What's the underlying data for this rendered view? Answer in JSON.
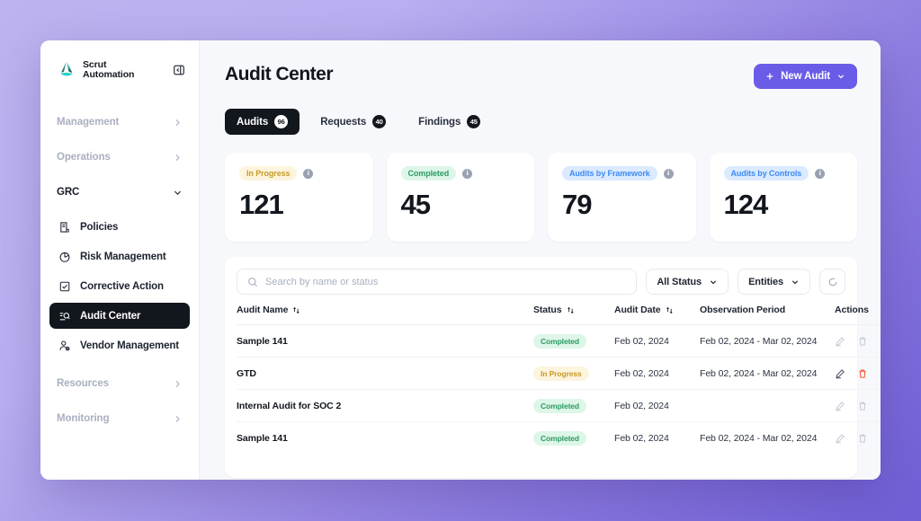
{
  "brand": {
    "name": "Scrut\nAutomation",
    "logo_icon": "scrut-logo-icon",
    "collapse_icon": "sidebar-collapse-icon"
  },
  "sidebar": {
    "groups": [
      {
        "label": "Management",
        "icon": "chevron-right-icon",
        "expanded": false
      },
      {
        "label": "Operations",
        "icon": "chevron-right-icon",
        "expanded": false
      },
      {
        "label": "GRC",
        "icon": "chevron-down-icon",
        "expanded": true
      }
    ],
    "items": [
      {
        "label": "Policies",
        "icon": "document-icon",
        "selected": false
      },
      {
        "label": "Risk Management",
        "icon": "pie-chart-icon",
        "selected": false
      },
      {
        "label": "Corrective Action",
        "icon": "checkbox-icon",
        "selected": false
      },
      {
        "label": "Audit Center",
        "icon": "audit-search-icon",
        "selected": true
      },
      {
        "label": "Vendor Management",
        "icon": "user-gear-icon",
        "selected": false
      }
    ],
    "groups_bottom": [
      {
        "label": "Resources",
        "icon": "chevron-right-icon"
      },
      {
        "label": "Monitoring",
        "icon": "chevron-right-icon"
      }
    ]
  },
  "header": {
    "title": "Audit Center",
    "new_button": {
      "label": "New Audit",
      "plus_icon": "plus-icon",
      "chevron_icon": "chevron-down-icon",
      "color": "#6b5ce7"
    }
  },
  "tabs": [
    {
      "label": "Audits",
      "badge": "96",
      "active": true
    },
    {
      "label": "Requests",
      "badge": "40",
      "active": false
    },
    {
      "label": "Findings",
      "badge": "45",
      "active": false
    }
  ],
  "stats": [
    {
      "label": "In Progress",
      "value": "121",
      "tone": "amber",
      "info_icon": "info-icon"
    },
    {
      "label": "Completed",
      "value": "45",
      "tone": "green",
      "info_icon": "info-icon"
    },
    {
      "label": "Audits by Framework",
      "value": "79",
      "tone": "blue",
      "info_icon": "info-icon"
    },
    {
      "label": "Audits by Controls",
      "value": "124",
      "tone": "blue",
      "info_icon": "info-icon"
    }
  ],
  "toolbar": {
    "search_placeholder": "Search by name or status",
    "search_value": "",
    "search_icon": "search-icon",
    "status_filter": {
      "label": "All Status",
      "icon": "chevron-down-icon"
    },
    "entities_filter": {
      "label": "Entities",
      "icon": "chevron-down-icon"
    },
    "refresh_icon": "refresh-icon"
  },
  "table": {
    "columns": [
      {
        "label": "Audit Name",
        "sortable": true
      },
      {
        "label": "Status",
        "sortable": true
      },
      {
        "label": "Audit Date",
        "sortable": true
      },
      {
        "label": "Observation Period",
        "sortable": false
      },
      {
        "label": "Actions",
        "sortable": false
      }
    ],
    "rows": [
      {
        "name": "Sample 141",
        "status": "Completed",
        "status_tone": "green",
        "date": "Feb 02, 2024",
        "observation": "Feb 02, 2024 - Mar 02, 2024",
        "hot": false
      },
      {
        "name": "GTD",
        "status": "In Progress",
        "status_tone": "amber",
        "date": "Feb 02, 2024",
        "observation": "Feb 02, 2024 - Mar 02, 2024",
        "hot": true
      },
      {
        "name": "Internal Audit for SOC 2",
        "status": "Completed",
        "status_tone": "green",
        "date": "Feb 02, 2024",
        "observation": "",
        "hot": false
      },
      {
        "name": "Sample 141",
        "status": "Completed",
        "status_tone": "green",
        "date": "Feb 02, 2024",
        "observation": "Feb 02, 2024 - Mar 02, 2024",
        "hot": false
      }
    ],
    "row_actions": {
      "edit_icon": "edit-pencil-icon",
      "delete_icon": "trash-icon"
    }
  }
}
